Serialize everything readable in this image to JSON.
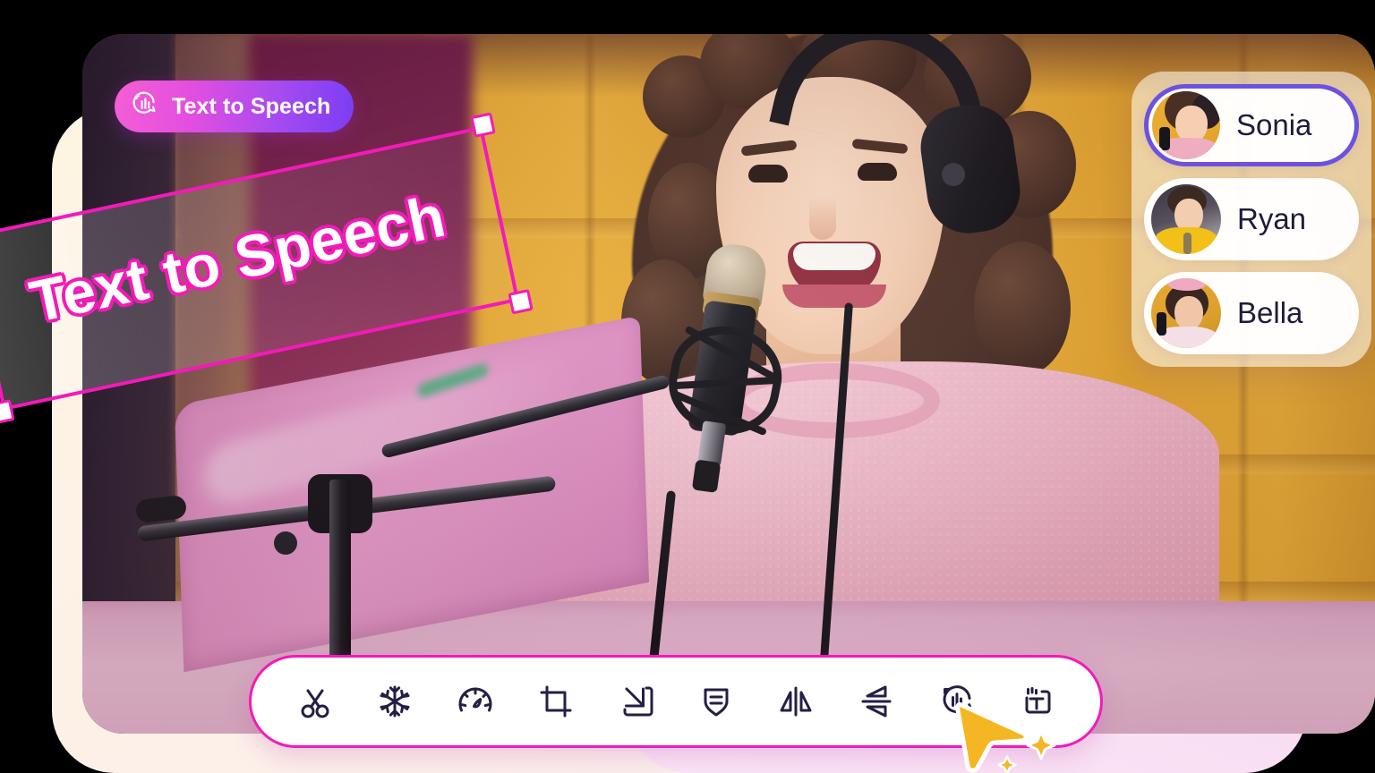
{
  "badge": {
    "label": "Text to Speech",
    "icon": "text-to-speech-icon",
    "gradient_from": "#f35fd4",
    "gradient_to": "#7b3df5"
  },
  "canvas_text_element": {
    "text": "Text to Speech",
    "selected": true,
    "selection_color": "#f21bb8",
    "rotation_deg": -12,
    "handles": [
      "top-left",
      "top-right",
      "bottom-left",
      "bottom-right"
    ]
  },
  "voice_panel": {
    "items": [
      {
        "name": "Sonia",
        "selected": true,
        "avatar": "sonia-avatar"
      },
      {
        "name": "Ryan",
        "selected": false,
        "avatar": "ryan-avatar"
      },
      {
        "name": "Bella",
        "selected": false,
        "avatar": "bella-avatar"
      }
    ],
    "selected_border_color": "#6b52e0",
    "name_color": "#1e1b3a"
  },
  "toolbar": {
    "border_color": "#f21bb8",
    "icon_color": "#241f44",
    "items": [
      {
        "icon": "scissors-split-icon",
        "label": "Split"
      },
      {
        "icon": "snowflake-freeze-icon",
        "label": "Freeze"
      },
      {
        "icon": "speedometer-speed-icon",
        "label": "Speed"
      },
      {
        "icon": "crop-icon",
        "label": "Crop"
      },
      {
        "icon": "export-arrow-icon",
        "label": "Export"
      },
      {
        "icon": "subtitle-shield-icon",
        "label": "Subtitle"
      },
      {
        "icon": "mirror-horizontal-icon",
        "label": "Mirror"
      },
      {
        "icon": "flip-vertical-icon",
        "label": "Flip"
      },
      {
        "icon": "text-to-speech-icon",
        "label": "Text to Speech",
        "active": true
      },
      {
        "icon": "text-title-icon",
        "label": "Text"
      }
    ]
  },
  "cursor": {
    "icon": "pointer-cursor-icon",
    "color": "#f5b623",
    "sparkles": 2
  },
  "scene": {
    "description": "Podcast creator smiling at a studio microphone wearing headphones and a pink knit sweater against an amber backdrop",
    "backdrop_color": "#e9ab33",
    "sweater_color": "#e8a8bc",
    "desk_color": "#ecc0d7"
  }
}
